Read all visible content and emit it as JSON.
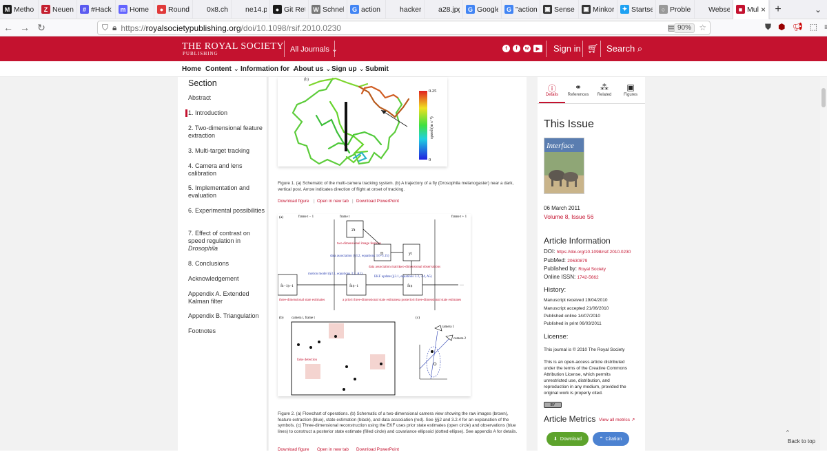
{
  "browser": {
    "tabs": [
      {
        "label": "Metho",
        "fav": "M",
        "color": "#1a1a1a"
      },
      {
        "label": "Neuent",
        "fav": "Z",
        "color": "#c41f2f"
      },
      {
        "label": "#Hack",
        "fav": "#",
        "color": "#5a5af0"
      },
      {
        "label": "Home",
        "fav": "m",
        "color": "#6364ff"
      },
      {
        "label": "Round",
        "fav": "●",
        "color": "#e03a3a"
      },
      {
        "label": "0x8.ch/Ha",
        "fav": "",
        "color": "#f0f0f4"
      },
      {
        "label": "ne14.png",
        "fav": "",
        "color": "#f0f0f4"
      },
      {
        "label": "Git Ret",
        "fav": "●",
        "color": "#1a1a1a"
      },
      {
        "label": "Schnell",
        "fav": "W",
        "color": "#777777"
      },
      {
        "label": "action",
        "fav": "G",
        "color": "#4285f4"
      },
      {
        "label": "hackersca",
        "fav": "",
        "color": "#f0f0f4"
      },
      {
        "label": "a28.jpg (J",
        "fav": "",
        "color": "#f0f0f4"
      },
      {
        "label": "Google",
        "fav": "G",
        "color": "#4285f4"
      },
      {
        "label": "\"action",
        "fav": "G",
        "color": "#4285f4"
      },
      {
        "label": "Sense",
        "fav": "▣",
        "color": "#333333"
      },
      {
        "label": "Minkor",
        "fav": "▣",
        "color": "#333333"
      },
      {
        "label": "Startse",
        "fav": "✦",
        "color": "#1da1f2"
      },
      {
        "label": "Proble",
        "fav": "○",
        "color": "#999999"
      },
      {
        "label": "Webseite",
        "fav": "",
        "color": "#f0f0f4"
      },
      {
        "label": "Multi",
        "fav": "■",
        "color": "#c4122f",
        "active": true
      }
    ],
    "close_icon": "×",
    "new_tab": "+",
    "url_domain": "royalsocietypublishing.org",
    "url_prefix": "https://",
    "url_path": "/doi/10.1098/rsif.2010.0230",
    "zoom": "90%"
  },
  "header": {
    "logo_line1": "THE ROYAL SOCIETY",
    "logo_line2": "PUBLISHING",
    "journals": "All Journals",
    "signin": "Sign in",
    "search": "Search"
  },
  "nav": [
    "Home",
    "Content",
    "Information for",
    "About us",
    "Sign up",
    "Submit"
  ],
  "toc": {
    "title": "Section",
    "items": [
      "Abstract",
      "1. Introduction",
      "2. Two-dimensional feature extraction",
      "3. Multi-target tracking",
      "4. Camera and lens calibration",
      "5. Implementation and evaluation",
      "6. Experimental possibilities",
      "7. Effect of contrast on speed regulation in Drosophila",
      "8. Conclusions",
      "Acknowledgement",
      "Appendix A. Extended Kalman filter",
      "Appendix B. Triangulation",
      "Footnotes"
    ]
  },
  "figure1": {
    "colorbar_max": "0.25",
    "colorbar_min": "0",
    "colorbar_label": "speed (m s⁻¹)",
    "caption": "Figure 1. (a) Schematic of the multi-camera tracking system. (b) A trajectory of a fly (Drosophila melanogaster) near a dark, vertical post. Arrow indicates direction of flight at onset of tracking.",
    "panel_label": "(b)"
  },
  "links": {
    "download": "Download figure",
    "newtab": "Open in new tab",
    "ppt": "Download PowerPoint"
  },
  "figure2": {
    "a": "(a)",
    "b": "(b)",
    "c": "(c)",
    "frame_prev": "frame t − 1",
    "frame_t": "frame t",
    "frame_next": "frame t + 1",
    "z_label": "Zt",
    "d_label": "D",
    "y_label": "yt",
    "s_prev": "Ŝt−1|t−1",
    "s_prior": "Ŝt|t−1",
    "s_post": "Ŝt|t",
    "two_d": "two-dimensional image features",
    "data_assoc": "data association (§3.2, equations 3.6–3.15)",
    "motion_model": "motion model (§3.1, equations 3.2, A1)",
    "dam": "data association matrix",
    "two_d_obs": "two-dimensional observations",
    "ekf": "EKF update (§3.1, equations 3.3, 3.4, A5)",
    "est_prev": "three-dimensional state estimates",
    "apriori": "a priori three-dimensional state estimates",
    "aposteriori": "a posteriori three-dimensional state estimates",
    "camera_title": "camera i, frame t",
    "false_det": "false detection",
    "camera1": "camera 1",
    "camera2": "camera 2",
    "ellipsis": "···"
  },
  "caption2": "Figure 2. (a) Flowchart of operations. (b) Schematic of a two-dimensional camera view showing the raw images (brown), feature extraction (blue), state estimation (black), and data association (red). See §§2 and 3.2.4 for an explanation of the symbols. (c) Three-dimensional reconstruction using the EKF uses prior state estimates (open circle) and observations (blue lines) to construct a posterior state estimate (filled circle) and covariance ellipsoid (dotted ellipse). See appendix A for details.",
  "right": {
    "tabs": [
      "Details",
      "References",
      "Related",
      "Figures"
    ],
    "this_issue": "This Issue",
    "cover_title": "Interface",
    "date": "06 March 2011",
    "volume": "Volume 8, Issue 56",
    "article_info": "Article Information",
    "doi_label": "DOI:",
    "doi": "https://doi.org/10.1098/rsif.2010.0230",
    "pubmed_label": "PubMed:",
    "pubmed": "20630879",
    "published_by_label": "Published by:",
    "published_by": "Royal Society",
    "issn_label": "Online ISSN:",
    "issn": "1742-5662",
    "history": "History:",
    "received": "Manuscript received 19/04/2010",
    "accepted": "Manuscript accepted 21/06/2010",
    "online": "Published online 14/07/2010",
    "print": "Published in print 06/03/2011",
    "license": "License:",
    "journal_line": "This journal is © 2010 The Royal Society",
    "license_text": "This is an open-access article distributed under the terms of the Creative Commons Attribution License, which permits unrestricted use, distribution, and reproduction in any medium, provided the original work is properly cited.",
    "cc": "BY",
    "metrics": "Article Metrics",
    "view_all": "View all metrics",
    "download_btn": "Download",
    "citation_btn": "Citation"
  },
  "back_to_top": "Back to top"
}
